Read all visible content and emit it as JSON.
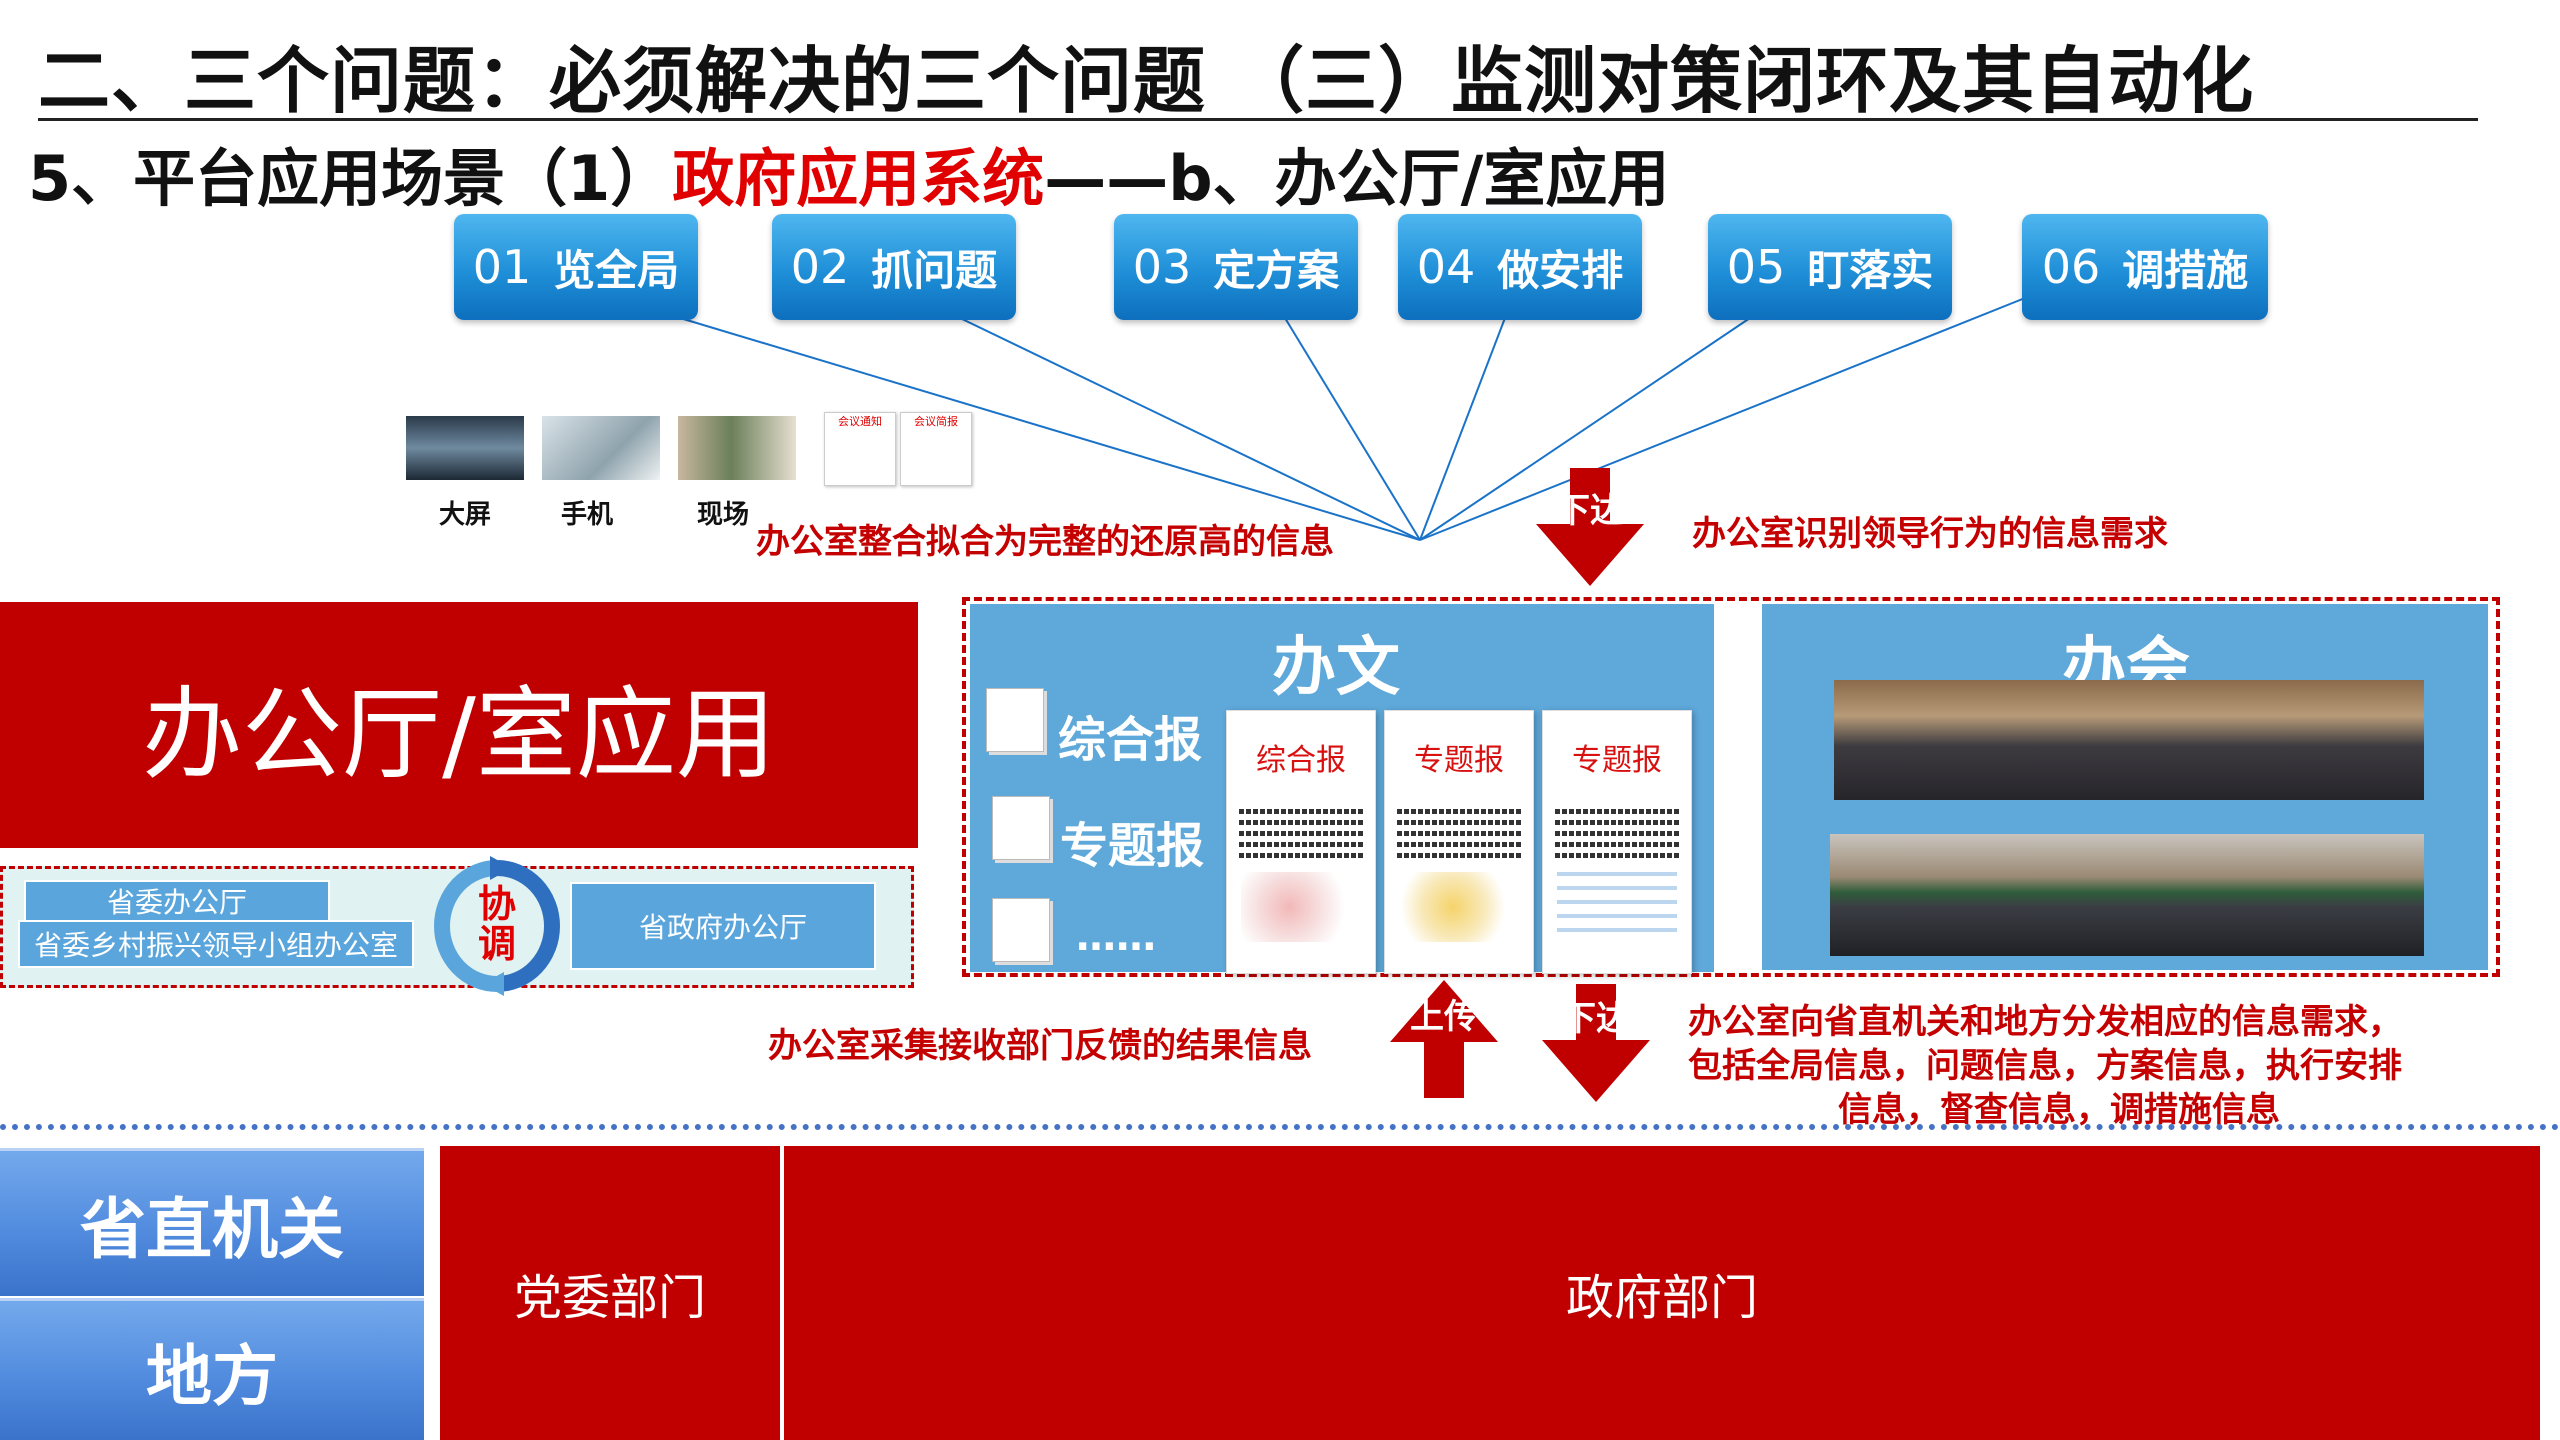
{
  "header": {
    "title": "二、三个问题：必须解决的三个问题 （三）监测对策闭环及其自动化",
    "subtitle_prefix": "5、平台应用场景（1）",
    "subtitle_red": "政府应用系统",
    "subtitle_suffix": "——b、办公厅/室应用"
  },
  "steps": [
    {
      "num": "01",
      "label": "览全局"
    },
    {
      "num": "02",
      "label": "抓问题"
    },
    {
      "num": "03",
      "label": "定方案"
    },
    {
      "num": "04",
      "label": "做安排"
    },
    {
      "num": "05",
      "label": "盯落实"
    },
    {
      "num": "06",
      "label": "调措施"
    }
  ],
  "channels": {
    "big_screen": "大屏",
    "mobile": "手机",
    "onsite": "现场",
    "doc1": "会议通知",
    "doc2": "会议简报"
  },
  "annotations": {
    "integrate": "办公室整合拟合为完整的还原高的信息",
    "identify": "办公室识别领导行为的信息需求",
    "collect": "办公室采集接收部门反馈的结果信息",
    "distribute_1": "办公室向省直机关和地方分发相应的信息需求，",
    "distribute_2": "包括全局信息，问题信息，方案信息，执行安排",
    "distribute_3": "信息，督查信息，调措施信息"
  },
  "arrows": {
    "down_top": "下达",
    "up": "上传",
    "down_bottom": "下达"
  },
  "office_app": {
    "title": "办公厅/室应用",
    "party_office": "省委办公厅",
    "rural_office": "省委乡村振兴领导小组办公室",
    "coordinate": "协调",
    "gov_office": "省政府办公厅"
  },
  "documents_panel": {
    "title": "办文",
    "types": [
      "综合报",
      "专题报",
      "……"
    ],
    "papers": [
      "综合报",
      "专题报",
      "专题报"
    ]
  },
  "meetings_panel": {
    "title": "办会"
  },
  "bottom": {
    "provincial": "省直机关",
    "local": "地方",
    "party_depts": "党委部门",
    "gov_depts": "政府部门"
  },
  "colors": {
    "brand_red": "#c00000",
    "accent_red": "#e00000",
    "panel_blue": "#5ea8da",
    "step_blue": "#1f8fd8",
    "side_blue": "#4f89dd"
  }
}
